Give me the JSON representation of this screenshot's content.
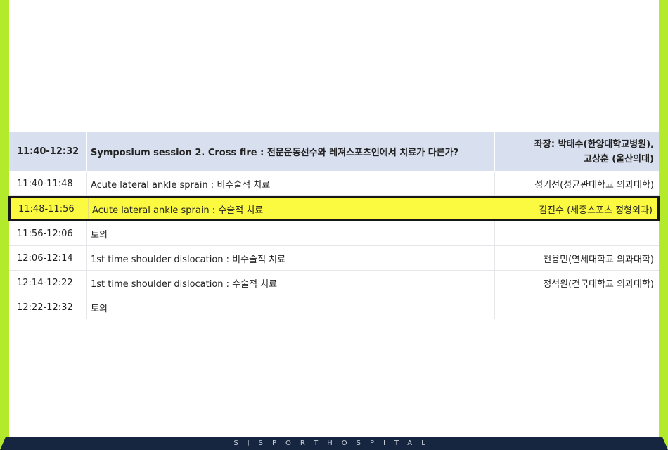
{
  "header": {
    "time": "11:40-12:32",
    "title": "Symposium session 2. Cross fire : 전문운동선수와 레져스포츠인에서 치료가 다른가?",
    "chair_line1": "좌장: 박태수(한양대학교병원),",
    "chair_line2": "고상훈 (울산의대)"
  },
  "rows": [
    {
      "time": "11:40-11:48",
      "title": "Acute lateral ankle sprain : 비수술적 치료",
      "speaker": "성기선(성균관대학교 의과대학)"
    },
    {
      "time": "11:48-11:56",
      "title": "Acute lateral ankle sprain : 수술적 치료",
      "speaker": "김진수 (세종스포츠 정형외과)"
    },
    {
      "time": "11:56-12:06",
      "title": "토의",
      "speaker": ""
    },
    {
      "time": "12:06-12:14",
      "title": "1st time shoulder dislocation : 비수술적 치료",
      "speaker": "천용민(연세대학교 의과대학)"
    },
    {
      "time": "12:14-12:22",
      "title": "1st time shoulder dislocation : 수술적 치료",
      "speaker": "정석원(건국대학교 의과대학)"
    },
    {
      "time": "12:22-12:32",
      "title": "토의",
      "speaker": ""
    }
  ],
  "highlight_color": "#fbfa40",
  "accent_green": "#b3ea2c",
  "footer": {
    "brand": "SJSPORTHOSPITAL"
  }
}
